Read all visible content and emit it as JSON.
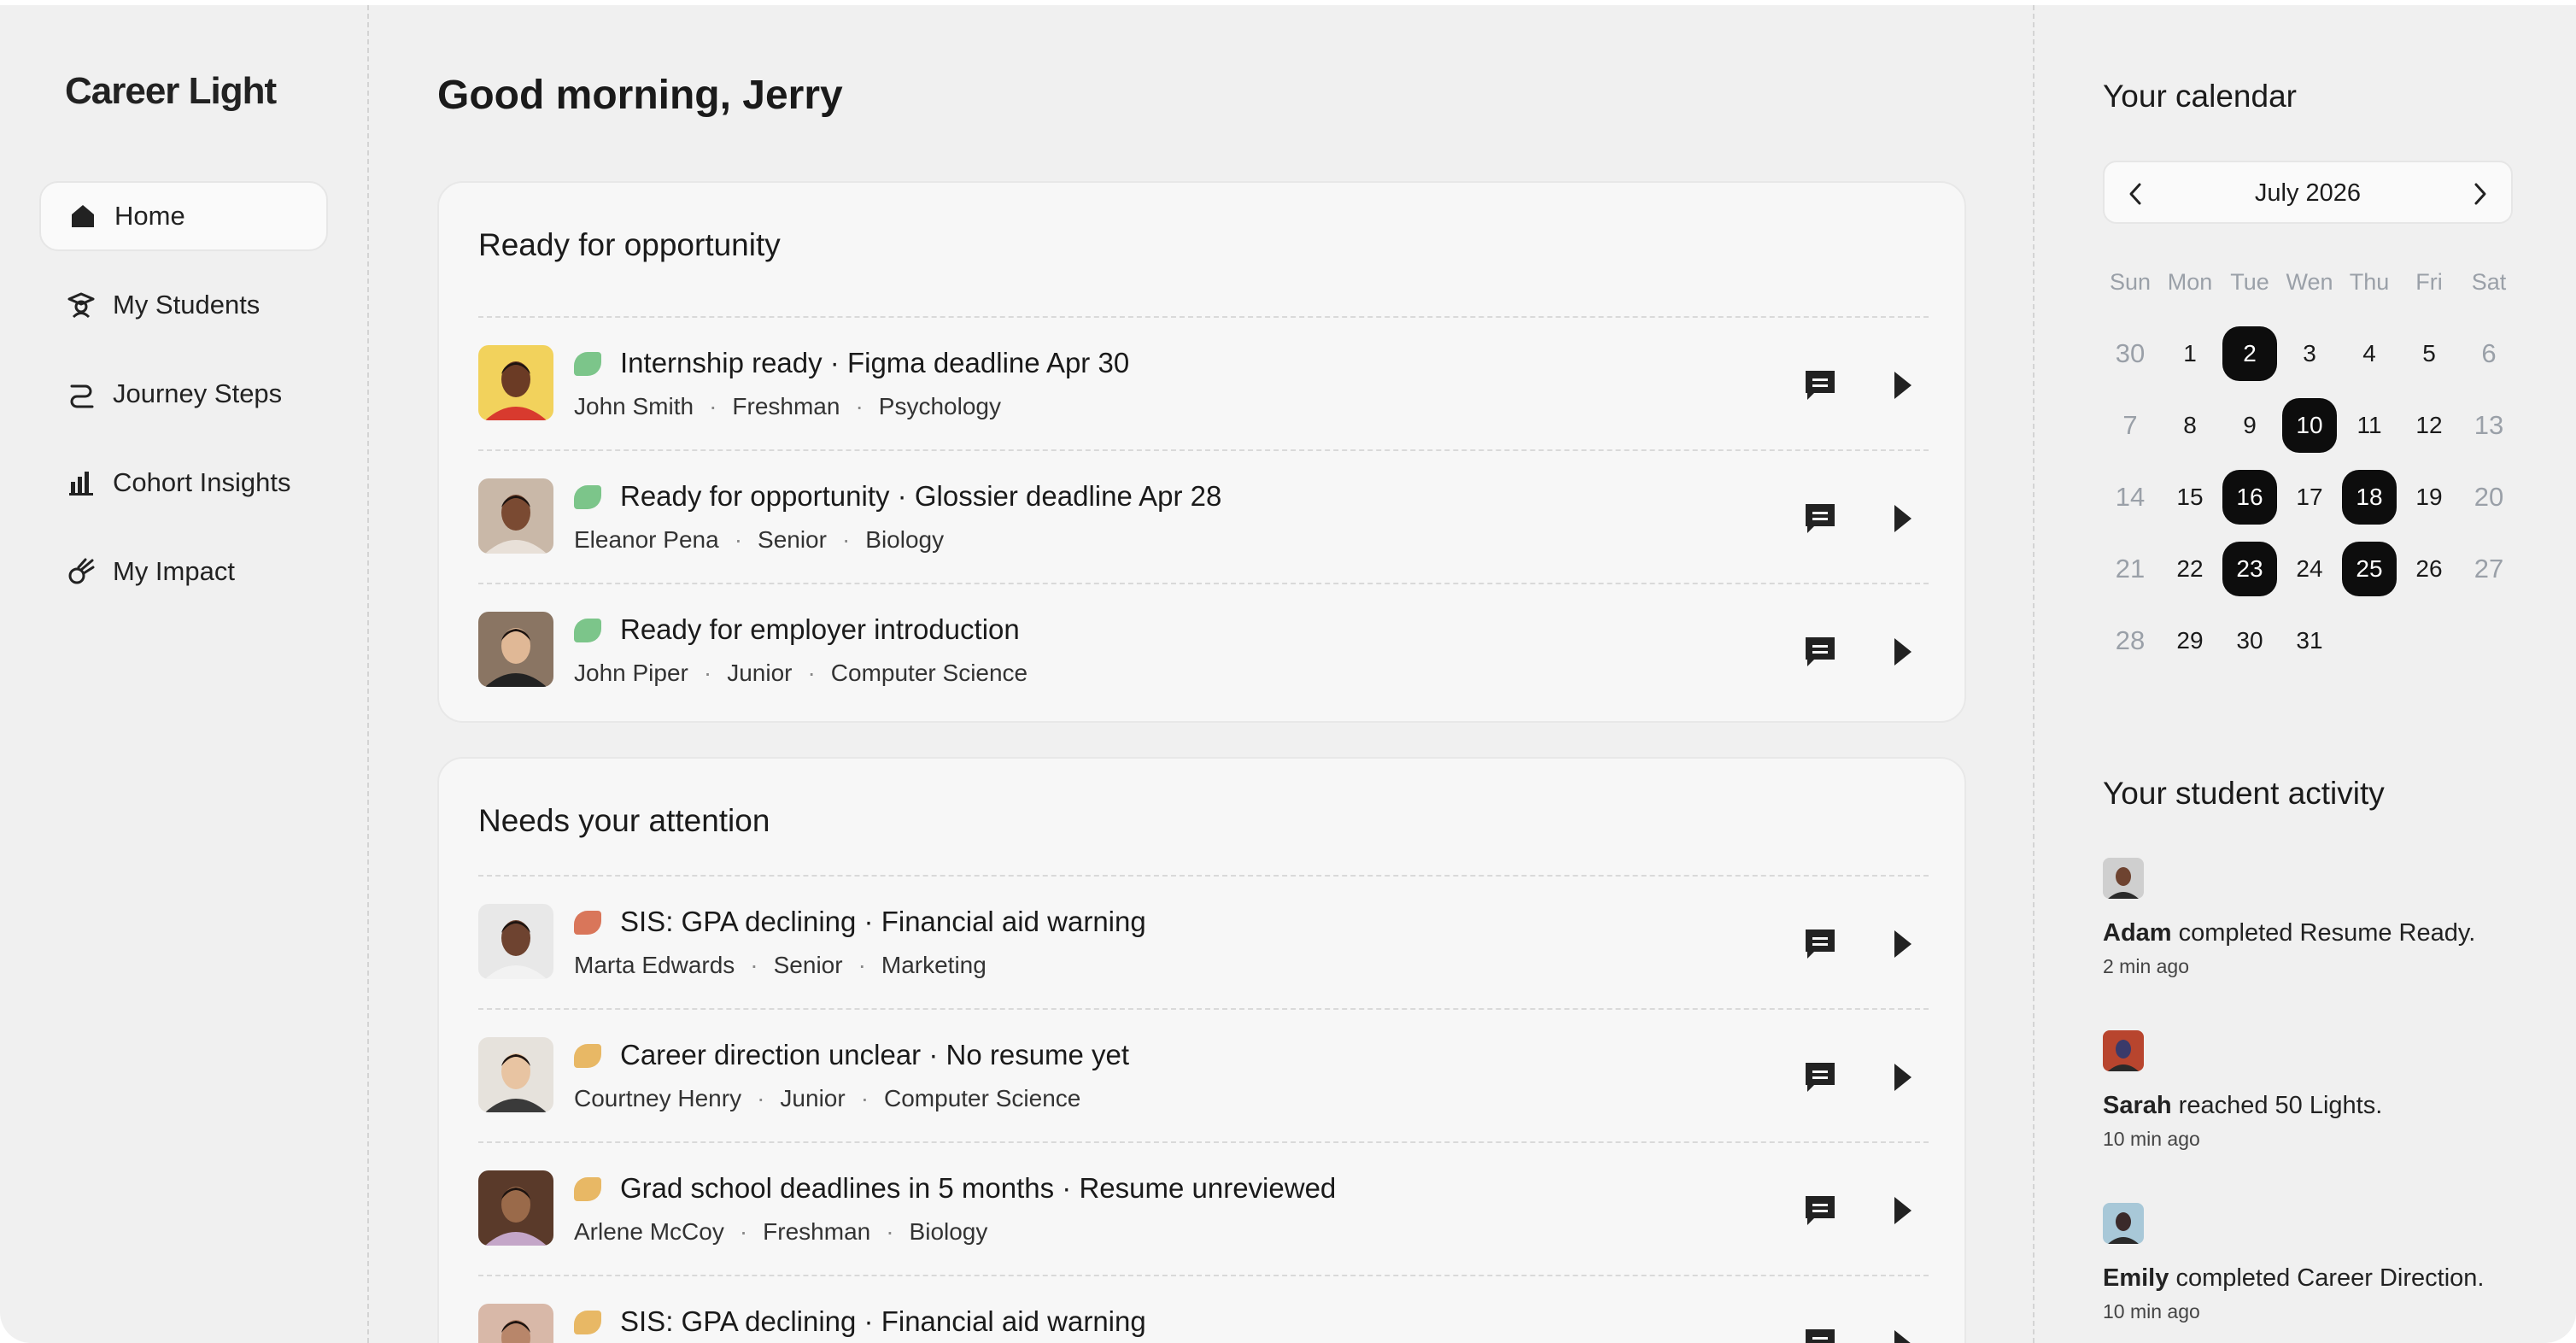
{
  "app": {
    "logo": "Career Light"
  },
  "sidebar": {
    "items": [
      {
        "label": "Home",
        "icon": "home-icon",
        "active": true
      },
      {
        "label": "My Students",
        "icon": "graduate-icon",
        "active": false
      },
      {
        "label": "Journey Steps",
        "icon": "path-icon",
        "active": false
      },
      {
        "label": "Cohort Insights",
        "icon": "bar-chart-icon",
        "active": false
      },
      {
        "label": "My Impact",
        "icon": "meteor-icon",
        "active": false
      }
    ]
  },
  "main": {
    "greeting": "Good morning, Jerry",
    "sections": [
      {
        "title": "Ready for opportunity",
        "rows": [
          {
            "title": "Internship ready · Figma deadline Apr 30",
            "name": "John Smith",
            "year": "Freshman",
            "major": "Psychology",
            "status_color": "#7cc58a",
            "avatar_bg": "#f2d25c",
            "skin": "#6b3b25",
            "shirt": "#d83a2e"
          },
          {
            "title": "Ready for opportunity · Glossier deadline Apr 28",
            "name": "Eleanor Pena",
            "year": "Senior",
            "major": "Biology",
            "status_color": "#7cc58a",
            "avatar_bg": "#c9b8a8",
            "skin": "#7a4a32",
            "shirt": "#e8e0d8"
          },
          {
            "title": "Ready for employer introduction",
            "name": "John Piper",
            "year": "Junior",
            "major": "Computer Science",
            "status_color": "#7cc58a",
            "avatar_bg": "#8a7563",
            "skin": "#e0b896",
            "shirt": "#222222"
          }
        ]
      },
      {
        "title": "Needs your attention",
        "rows": [
          {
            "title": "SIS: GPA declining · Financial aid warning",
            "name": "Marta Edwards",
            "year": "Senior",
            "major": "Marketing",
            "status_color": "#d9765a",
            "avatar_bg": "#e8e8e8",
            "skin": "#6e4330",
            "shirt": "#f2f2f2"
          },
          {
            "title": "Career direction unclear · No resume yet",
            "name": "Courtney Henry",
            "year": "Junior",
            "major": "Computer Science",
            "status_color": "#e8b865",
            "avatar_bg": "#e6e2dc",
            "skin": "#e8c4a2",
            "shirt": "#3a3a3a"
          },
          {
            "title": "Grad school deadlines in 5 months · Resume unreviewed",
            "name": "Arlene McCoy",
            "year": "Freshman",
            "major": "Biology",
            "status_color": "#e8b865",
            "avatar_bg": "#5a3a2a",
            "skin": "#9a6a4a",
            "shirt": "#c4a6c8"
          },
          {
            "title": "SIS: GPA declining · Financial aid warning",
            "name": "",
            "year": "",
            "major": "",
            "status_color": "#e8b865",
            "avatar_bg": "#d8b8a8",
            "skin": "#b8866a",
            "shirt": "#c8a090"
          }
        ]
      }
    ]
  },
  "calendar": {
    "title": "Your calendar",
    "month_label": "July 2026",
    "weekdays": [
      "Sun",
      "Mon",
      "Tue",
      "Wen",
      "Thu",
      "Fri",
      "Sat"
    ],
    "weeks": [
      [
        {
          "d": "30",
          "m": true
        },
        {
          "d": "1"
        },
        {
          "d": "2",
          "x": true
        },
        {
          "d": "3"
        },
        {
          "d": "4"
        },
        {
          "d": "5"
        },
        {
          "d": "6",
          "m": true
        }
      ],
      [
        {
          "d": "7",
          "m": true
        },
        {
          "d": "8"
        },
        {
          "d": "9"
        },
        {
          "d": "10",
          "x": true
        },
        {
          "d": "11"
        },
        {
          "d": "12"
        },
        {
          "d": "13",
          "m": true
        }
      ],
      [
        {
          "d": "14",
          "m": true
        },
        {
          "d": "15"
        },
        {
          "d": "16",
          "x": true
        },
        {
          "d": "17"
        },
        {
          "d": "18",
          "x": true
        },
        {
          "d": "19"
        },
        {
          "d": "20",
          "m": true
        }
      ],
      [
        {
          "d": "21",
          "m": true
        },
        {
          "d": "22"
        },
        {
          "d": "23",
          "x": true
        },
        {
          "d": "24"
        },
        {
          "d": "25",
          "x": true
        },
        {
          "d": "26"
        },
        {
          "d": "27",
          "m": true
        }
      ],
      [
        {
          "d": "28",
          "m": true
        },
        {
          "d": "29"
        },
        {
          "d": "30"
        },
        {
          "d": "31"
        }
      ]
    ]
  },
  "activity": {
    "title": "Your student activity",
    "items": [
      {
        "name": "Adam",
        "text": "completed Resume Ready.",
        "time": "2 min ago",
        "avatar_bg": "#cfcfcf",
        "skin": "#6e4330"
      },
      {
        "name": "Sarah",
        "text": "reached 50 Lights.",
        "time": "10 min ago",
        "avatar_bg": "#b8452e",
        "skin": "#3a3a6a"
      },
      {
        "name": "Emily",
        "text": "completed Career Direction.",
        "time": "10 min ago",
        "avatar_bg": "#a8c8d8",
        "skin": "#3a2a2a"
      }
    ]
  }
}
